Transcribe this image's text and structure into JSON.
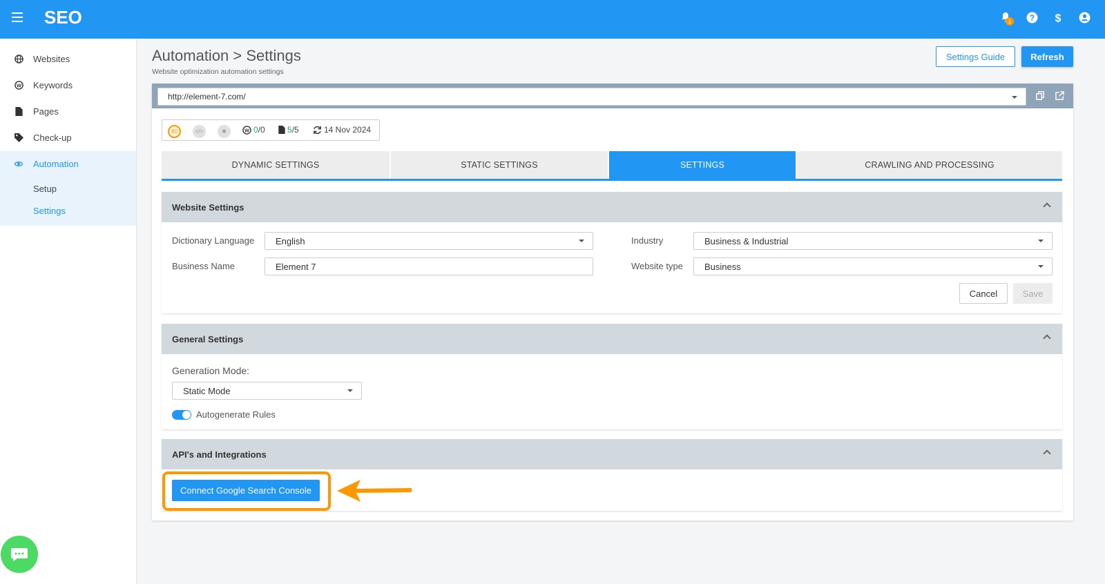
{
  "app": {
    "brand": "SEO",
    "notification_count": "1"
  },
  "sidebar": {
    "items": [
      {
        "label": "Websites",
        "icon": "globe-icon"
      },
      {
        "label": "Keywords",
        "icon": "w-circle-icon"
      },
      {
        "label": "Pages",
        "icon": "file-icon"
      },
      {
        "label": "Check-up",
        "icon": "tag-icon"
      },
      {
        "label": "Automation",
        "icon": "eye-icon"
      }
    ],
    "sub_items": [
      "Setup",
      "Settings"
    ]
  },
  "header": {
    "title": "Automation > Settings",
    "subtitle": "Website optimization automation settings",
    "guide_button": "Settings Guide",
    "refresh_button": "Refresh"
  },
  "url_bar": {
    "url": "http://element-7.com/"
  },
  "stats": {
    "score": "80",
    "keywords_a": "0",
    "keywords_b": "/0",
    "pages_a": "5",
    "pages_b": "/5",
    "date": "14 Nov 2024"
  },
  "tabs": [
    {
      "label": "DYNAMIC SETTINGS"
    },
    {
      "label": "STATIC SETTINGS"
    },
    {
      "label": "SETTINGS"
    },
    {
      "label": "CRAWLING AND PROCESSING"
    }
  ],
  "website_settings": {
    "title": "Website Settings",
    "dictionary_language_label": "Dictionary Language",
    "dictionary_language_value": "English",
    "business_name_label": "Business Name",
    "business_name_value": "Element 7",
    "industry_label": "Industry",
    "industry_value": "Business & Industrial",
    "website_type_label": "Website type",
    "website_type_value": "Business",
    "cancel_button": "Cancel",
    "save_button": "Save"
  },
  "general_settings": {
    "title": "General Settings",
    "generation_mode_label": "Generation Mode:",
    "generation_mode_value": "Static Mode",
    "autogenerate_label": "Autogenerate Rules"
  },
  "api_integrations": {
    "title": "API's and Integrations",
    "connect_button": "Connect Google Search Console"
  },
  "colors": {
    "primary": "#2196f3",
    "highlight": "#ff9800",
    "chat": "#4cd964"
  }
}
